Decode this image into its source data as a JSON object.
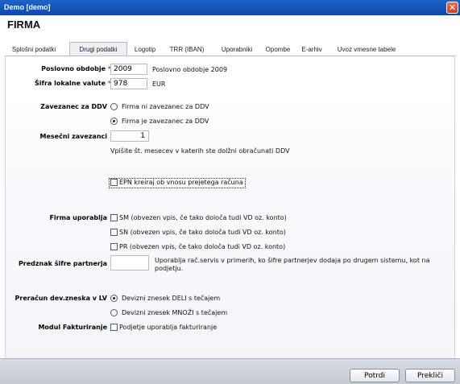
{
  "window": {
    "title": "Demo [demo]",
    "close_icon": "close-icon"
  },
  "header": {
    "firm": "FIRMA"
  },
  "tabs": [
    {
      "label": "Splošni podatki"
    },
    {
      "label": "Drugi podatki"
    },
    {
      "label": "Logotip"
    },
    {
      "label": "TRR (IBAN)"
    },
    {
      "label": "Uporabniki"
    },
    {
      "label": "Opombe"
    },
    {
      "label": "E-arhiv"
    },
    {
      "label": "Uvoz vmesne tabele"
    }
  ],
  "form": {
    "period_label": "Poslovno obdobje",
    "period_value": "2009",
    "period_desc": "Poslovno obdobje 2009",
    "currency_label": "Šifra lokalne valute",
    "currency_value": "978",
    "currency_desc": "EUR",
    "req_mark": "*",
    "vat_label": "Zavezanec za DDV",
    "vat_opt1": "Firma ni zavezanec za DDV",
    "vat_opt2": "Firma je zavezanec za DDV",
    "monthly_label": "Mesečni zavezanci",
    "monthly_value": "1",
    "monthly_hint": "Vpišite št. mesecev v katerih ste dolžni obračunati DDV",
    "epn_label": "EPN kreiraj ob vnosu prejetega računa",
    "uses_label": "Firma uporablja",
    "uses_sm": "SM (obvezen vpis, če tako določa tudi VD oz. konto)",
    "uses_sn": "SN (obvezen vpis, če tako določa tudi VD oz. konto)",
    "uses_pr": "PR (obvezen vpis, če tako določa tudi VD oz. konto)",
    "prefix_label": "Predznak šifre partnerja",
    "prefix_value": "",
    "prefix_hint1": "Uporablja rač.servis v primerih, ko šifre partnerjev dodaja po drugem sistemu, kot na",
    "prefix_hint2": "podjetju.",
    "conv_label": "Preračun dev.zneska v LV",
    "conv_opt1": "Devizni znesek DELI s tečajem",
    "conv_opt2": "Devizni znesek MNOŽI s tečajem",
    "invoice_label": "Modul Fakturiranje",
    "invoice_opt": "Podjetje uporablja fakturiranje"
  },
  "buttons": {
    "confirm": "Potrdi",
    "cancel": "Prekliči"
  }
}
